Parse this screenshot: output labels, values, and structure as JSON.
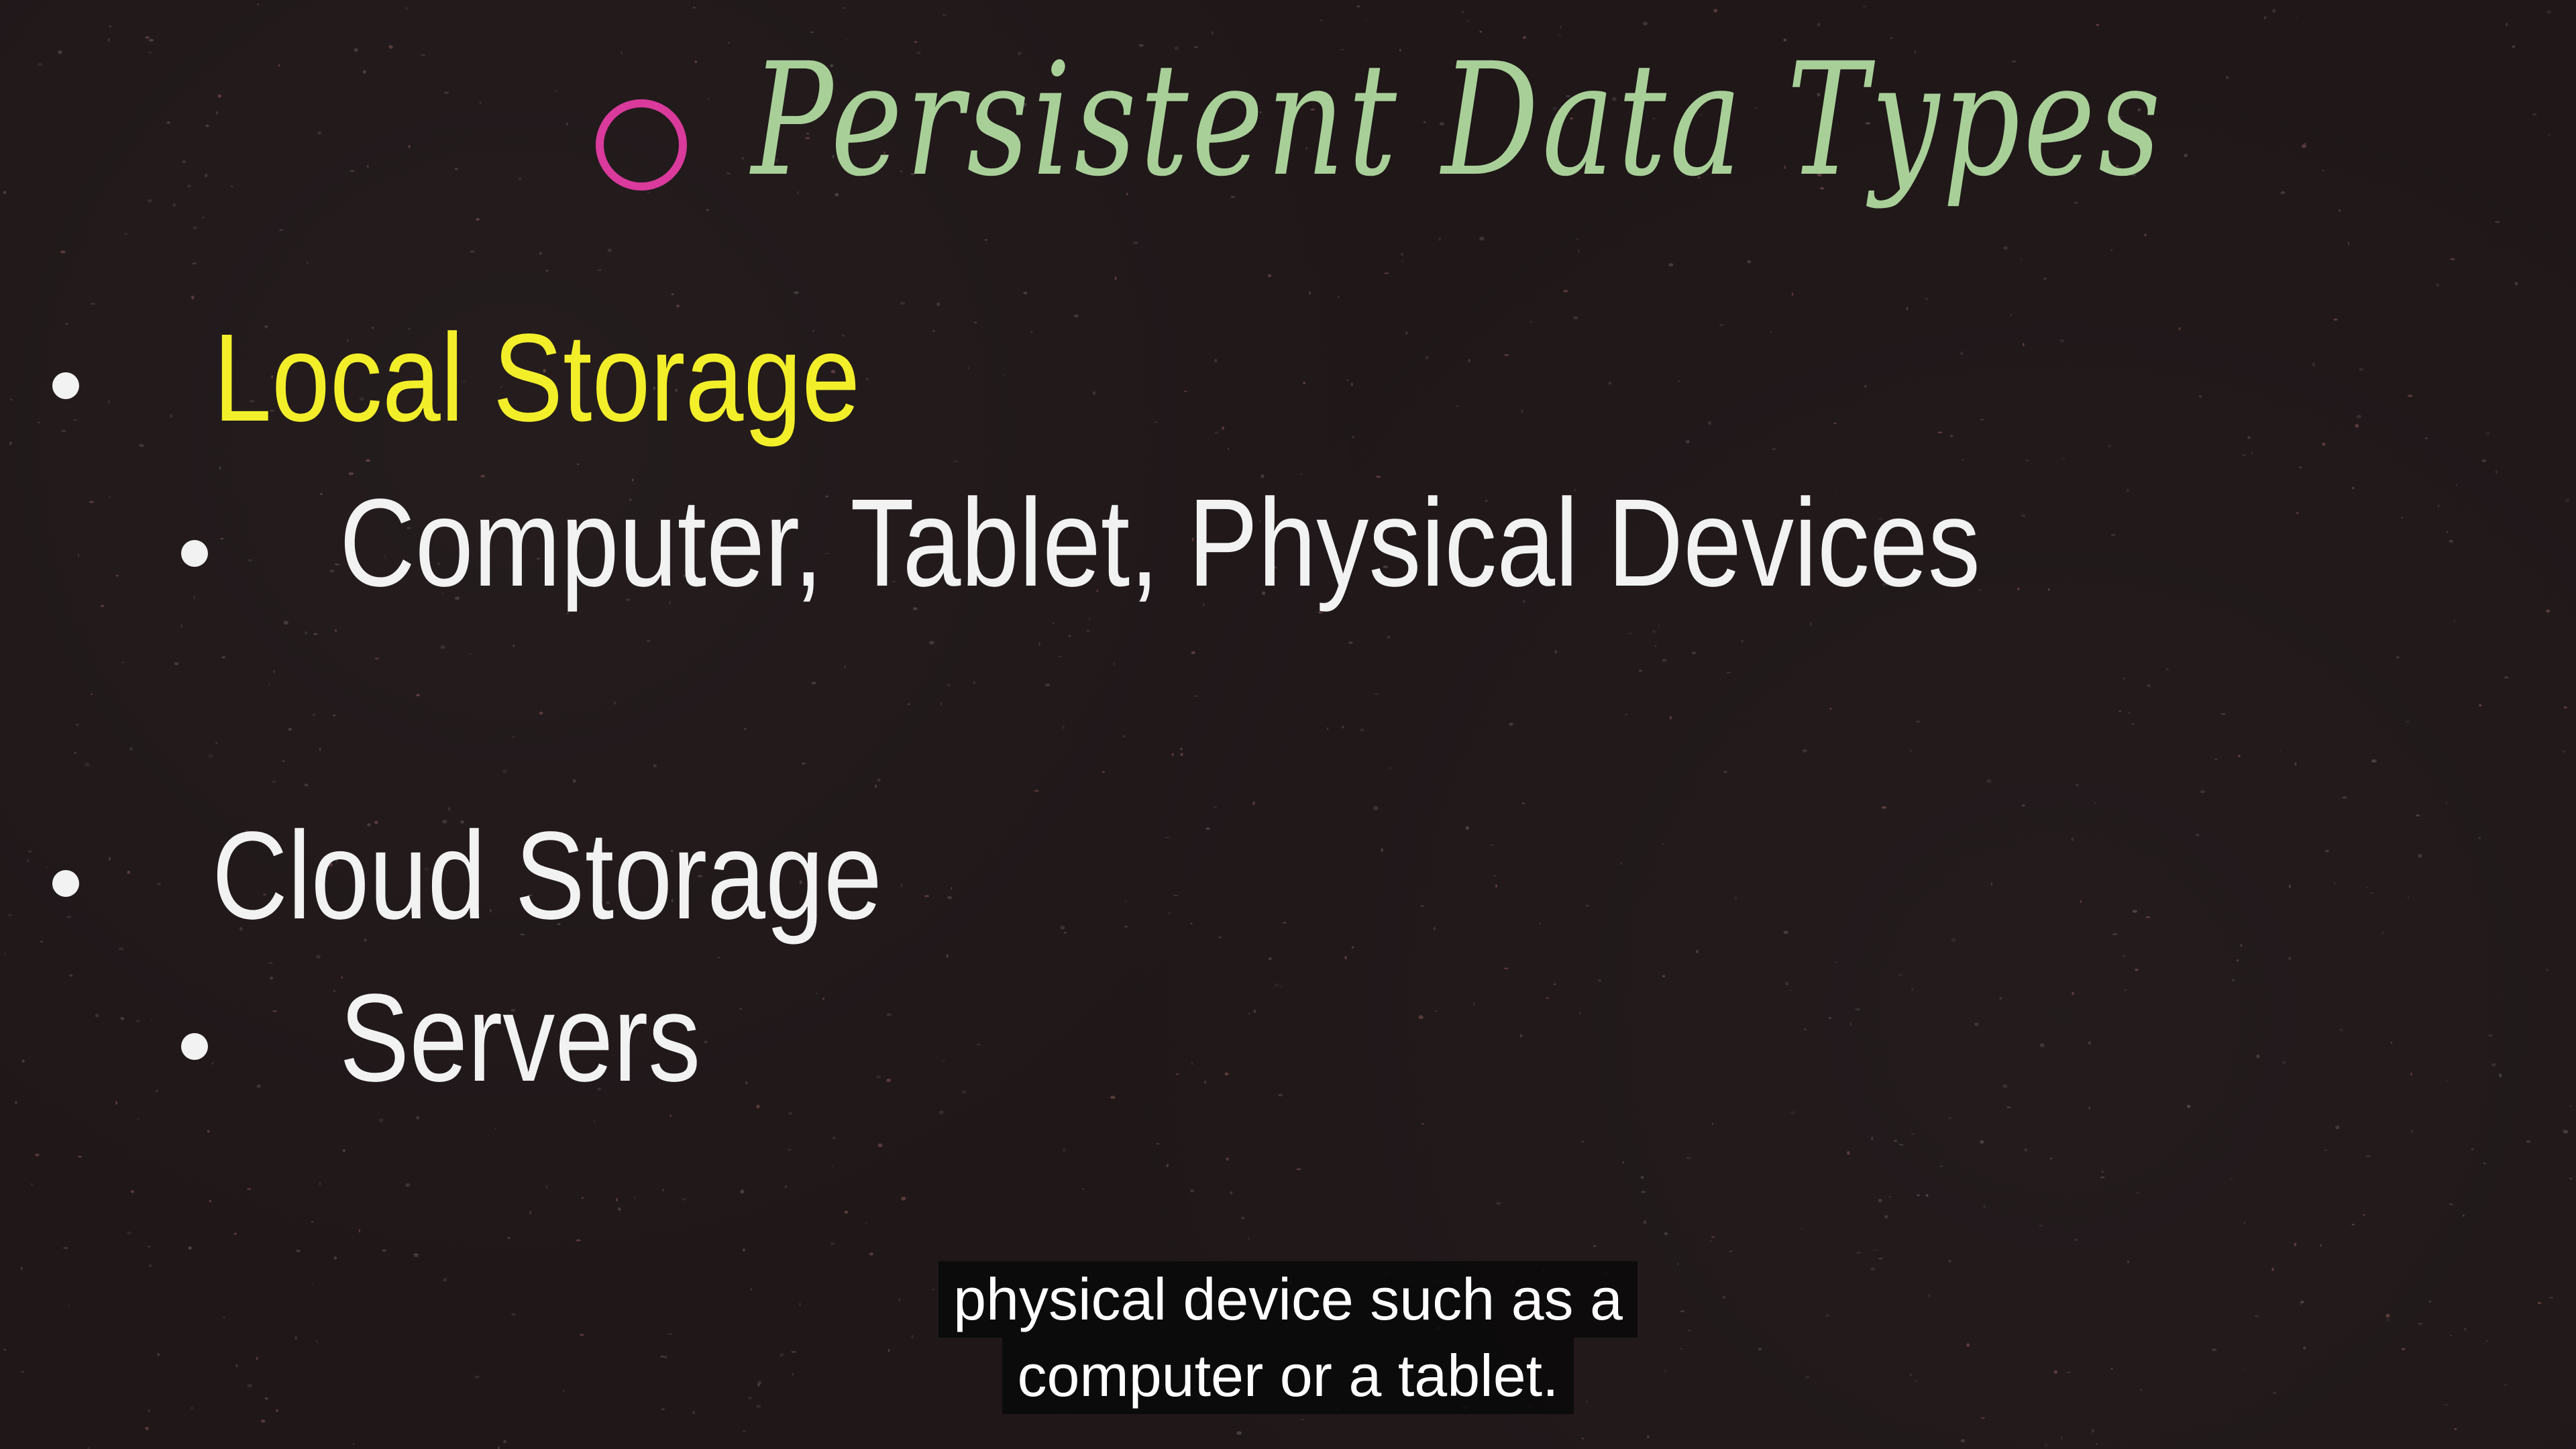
{
  "slide": {
    "title": "Persistent Data Types",
    "colors": {
      "background": "#1f1718",
      "title": "#a8cf98",
      "circle": "#d93a9c",
      "highlight": "#f2ef2a",
      "text": "#f2f2f2"
    },
    "items": [
      {
        "label": "Local Storage",
        "highlighted": true,
        "subitems": [
          {
            "label": "Computer, Tablet, Physical Devices"
          }
        ]
      },
      {
        "label": "Cloud Storage",
        "highlighted": false,
        "subitems": [
          {
            "label": "Servers"
          }
        ]
      }
    ]
  },
  "caption": {
    "lines": [
      "physical device such as a",
      "computer or a tablet."
    ]
  }
}
